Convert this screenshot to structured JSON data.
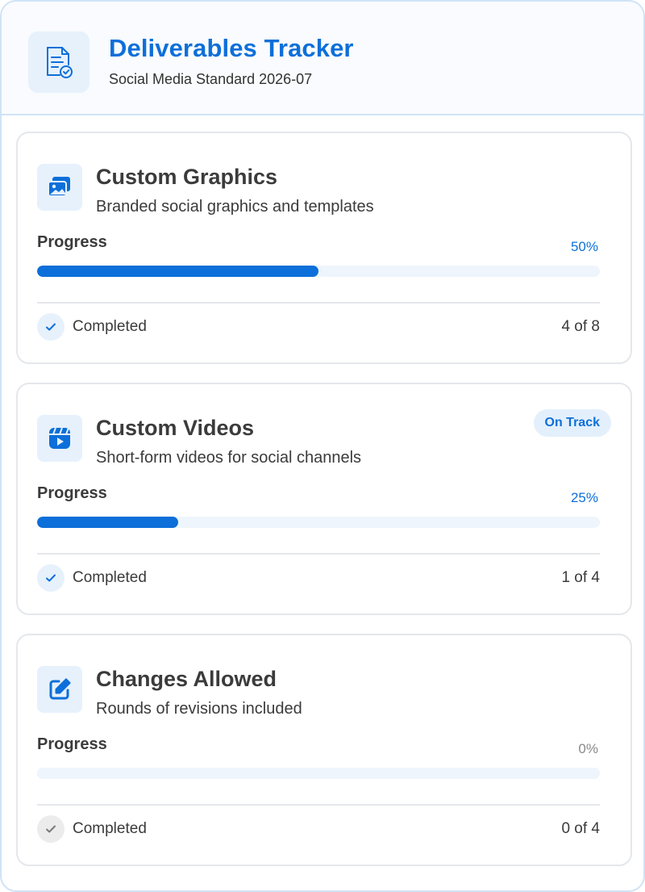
{
  "header": {
    "title": "Deliverables Tracker",
    "subtitle": "Social Media Standard 2026-07",
    "icon": "document-check-icon"
  },
  "accent_color": "#0d6fd9",
  "cards": [
    {
      "icon": "images-icon",
      "title": "Custom Graphics",
      "description": "Branded social graphics and templates",
      "badge": "",
      "progress_label": "Progress",
      "progress_percent_text": "50%",
      "progress_fraction": 0.5,
      "completed_label": "Completed",
      "completed_count": "4 of 8"
    },
    {
      "icon": "video-play-icon",
      "title": "Custom Videos",
      "description": "Short-form videos for social channels",
      "badge": "On Track",
      "progress_label": "Progress",
      "progress_percent_text": "25%",
      "progress_fraction": 0.25,
      "completed_label": "Completed",
      "completed_count": "1 of 4"
    },
    {
      "icon": "edit-pencil-icon",
      "title": "Changes Allowed",
      "description": "Rounds of revisions included",
      "badge": "",
      "progress_label": "Progress",
      "progress_percent_text": "0%",
      "progress_fraction": 0,
      "completed_label": "Completed",
      "completed_count": "0 of 4"
    }
  ]
}
